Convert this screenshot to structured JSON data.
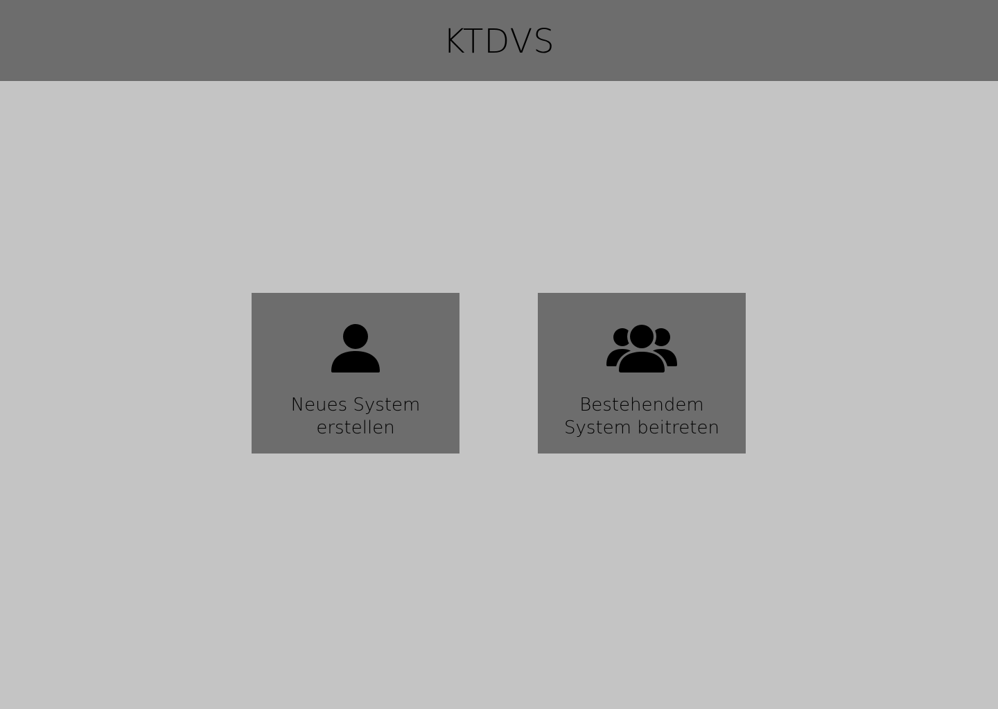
{
  "header": {
    "title": "KTDVS"
  },
  "cards": [
    {
      "label": "Neues System erstellen",
      "icon": "user-icon"
    },
    {
      "label": "Bestehendem System beitreten",
      "icon": "users-icon"
    }
  ],
  "colors": {
    "header_background": "#6d6d6d",
    "page_background": "#c4c4c4",
    "card_background": "#6d6d6d",
    "text": "#000000"
  }
}
